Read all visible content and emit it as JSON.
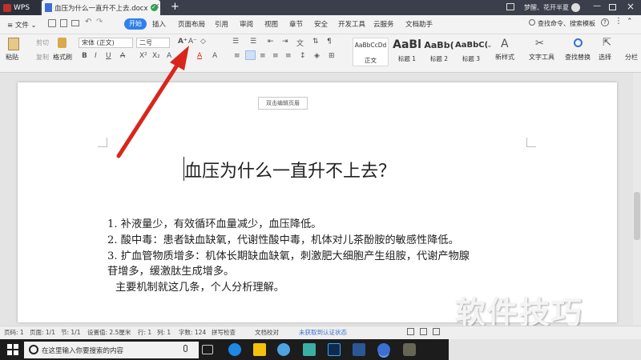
{
  "titlebar": {
    "app_label": "WPS",
    "doc_tab": "血压为什么一直升不上去.docx",
    "new_tab": "+",
    "user": "梦醒、花开半夏"
  },
  "menubar": {
    "file": "≡ 文件 ⌄",
    "items": [
      "开始",
      "插入",
      "页面布局",
      "引用",
      "审阅",
      "视图",
      "章节",
      "安全",
      "开发工具",
      "云服务",
      "文档助手"
    ],
    "search": "查找命令、搜索模板"
  },
  "ribbon": {
    "paste": "粘贴",
    "cut": "剪切",
    "copy": "复制",
    "format_painter": "格式刷",
    "font_name": "宋体 (正文)",
    "font_size": "二号",
    "styles": [
      {
        "preview": "AaBbCcDd",
        "name": "正文"
      },
      {
        "preview": "AaBl",
        "name": "标题 1"
      },
      {
        "preview": "AaBb(",
        "name": "标题 2"
      },
      {
        "preview": "AaBbC(",
        "name": "标题 3"
      }
    ],
    "new_style": "新样式",
    "text_tools": "文字工具",
    "find_replace": "查找替换",
    "select": "选择",
    "split": "分栏"
  },
  "document": {
    "header_button": "双击编辑页眉",
    "title": "血压为什么一直升不上去？",
    "lines": [
      "1.  补液量少，有效循环血量减少，血压降低。",
      "2.  酸中毒：患者缺血缺氧，代谢性酸中毒，机体对儿茶酚胺的敏感性降低。",
      "3.  扩血管物质增多：机体长期缺血缺氧，刺激肥大细胞产生组胺，代谢产物腺",
      "苷增多，缓激肽生成增多。",
      "主要机制就这几条，个人分析理解。"
    ]
  },
  "statusbar": {
    "page_no": "页码: 1",
    "pages": "页面: 1/1",
    "section": "节: 1/1",
    "setting": "设置值: 2.5厘米",
    "row": "行: 1",
    "col": "列: 1",
    "words": "字数: 124",
    "spell": "拼写检查",
    "proof": "文档校对",
    "cert": "未获取到认证状态"
  },
  "taskbar": {
    "search_placeholder": "在这里输入你要搜索的内容"
  },
  "watermark": "软件技巧",
  "colors": {
    "accent": "#2f80ed",
    "arrow": "#d9261c",
    "titlebar": "#3a3f4b"
  }
}
